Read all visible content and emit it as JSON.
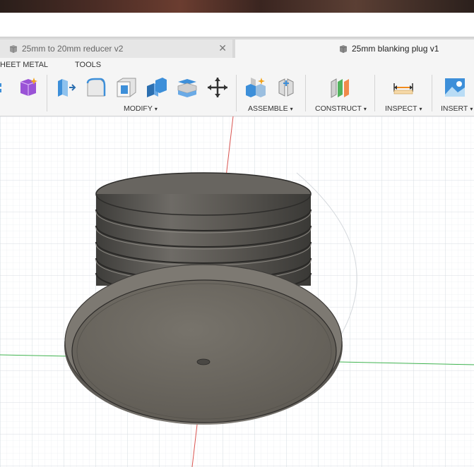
{
  "tabs": [
    {
      "label": "25mm to 20mm reducer v2",
      "active": false,
      "icon": "component-doc-icon"
    },
    {
      "label": "25mm blanking plug v1",
      "active": true,
      "icon": "component-doc-icon"
    }
  ],
  "tab_close_glyph": "✕",
  "toolbar": {
    "categories": {
      "sheet_metal": "HEET METAL",
      "tools": "TOOLS"
    },
    "groups": {
      "modify": "MODIFY",
      "assemble": "ASSEMBLE",
      "construct": "CONSTRUCT",
      "inspect": "INSPECT",
      "insert": "INSERT"
    },
    "caret": "▾"
  },
  "colors": {
    "axis_x": "#3fb34f",
    "axis_y": "#d9534f",
    "grid": "#d7dde3",
    "body": "#5e5b55",
    "accent_blue": "#3d8fd9"
  }
}
